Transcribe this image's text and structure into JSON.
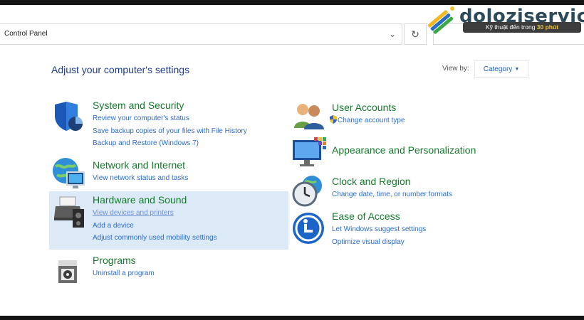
{
  "address_bar": {
    "path": "Control Panel",
    "dropdown_icon": "chevron-down-icon",
    "refresh_icon": "refresh-icon"
  },
  "watermark": {
    "name": "doloziservice",
    "tagline_prefix": "Kỹ thuật đến trong ",
    "tagline_highlight": "30 phút",
    "highlight_color": "#f2c230"
  },
  "header": {
    "title": "Adjust your computer's settings",
    "view_by_label": "View by:",
    "view_by_value": "Category"
  },
  "left_categories": [
    {
      "title": "System and Security",
      "icon": "shield-icon",
      "links": [
        "Review your computer's status",
        "Save backup copies of your files with File History",
        "Backup and Restore (Windows 7)"
      ]
    },
    {
      "title": "Network and Internet",
      "icon": "globe-network-icon",
      "links": [
        "View network status and tasks"
      ]
    },
    {
      "title": "Hardware and Sound",
      "icon": "printer-speaker-icon",
      "highlighted": true,
      "links": [
        "View devices and printers",
        "Add a device",
        "Adjust commonly used mobility settings"
      ]
    },
    {
      "title": "Programs",
      "icon": "programs-box-icon",
      "links": [
        "Uninstall a program"
      ]
    }
  ],
  "right_categories": [
    {
      "title": "User Accounts",
      "icon": "users-icon",
      "links": [
        "Change account type"
      ],
      "link_icon": "uac-shield-icon"
    },
    {
      "title": "Appearance and Personalization",
      "icon": "monitor-palette-icon",
      "links": []
    },
    {
      "title": "Clock and Region",
      "icon": "clock-globe-icon",
      "links": [
        "Change date, time, or number formats"
      ]
    },
    {
      "title": "Ease of Access",
      "icon": "ease-of-access-icon",
      "links": [
        "Let Windows suggest settings",
        "Optimize visual display"
      ]
    }
  ],
  "colors": {
    "heading": "#1e3c8c",
    "category_title": "#157a2c",
    "link": "#2b6cd1",
    "highlight": "#dceaf8"
  }
}
